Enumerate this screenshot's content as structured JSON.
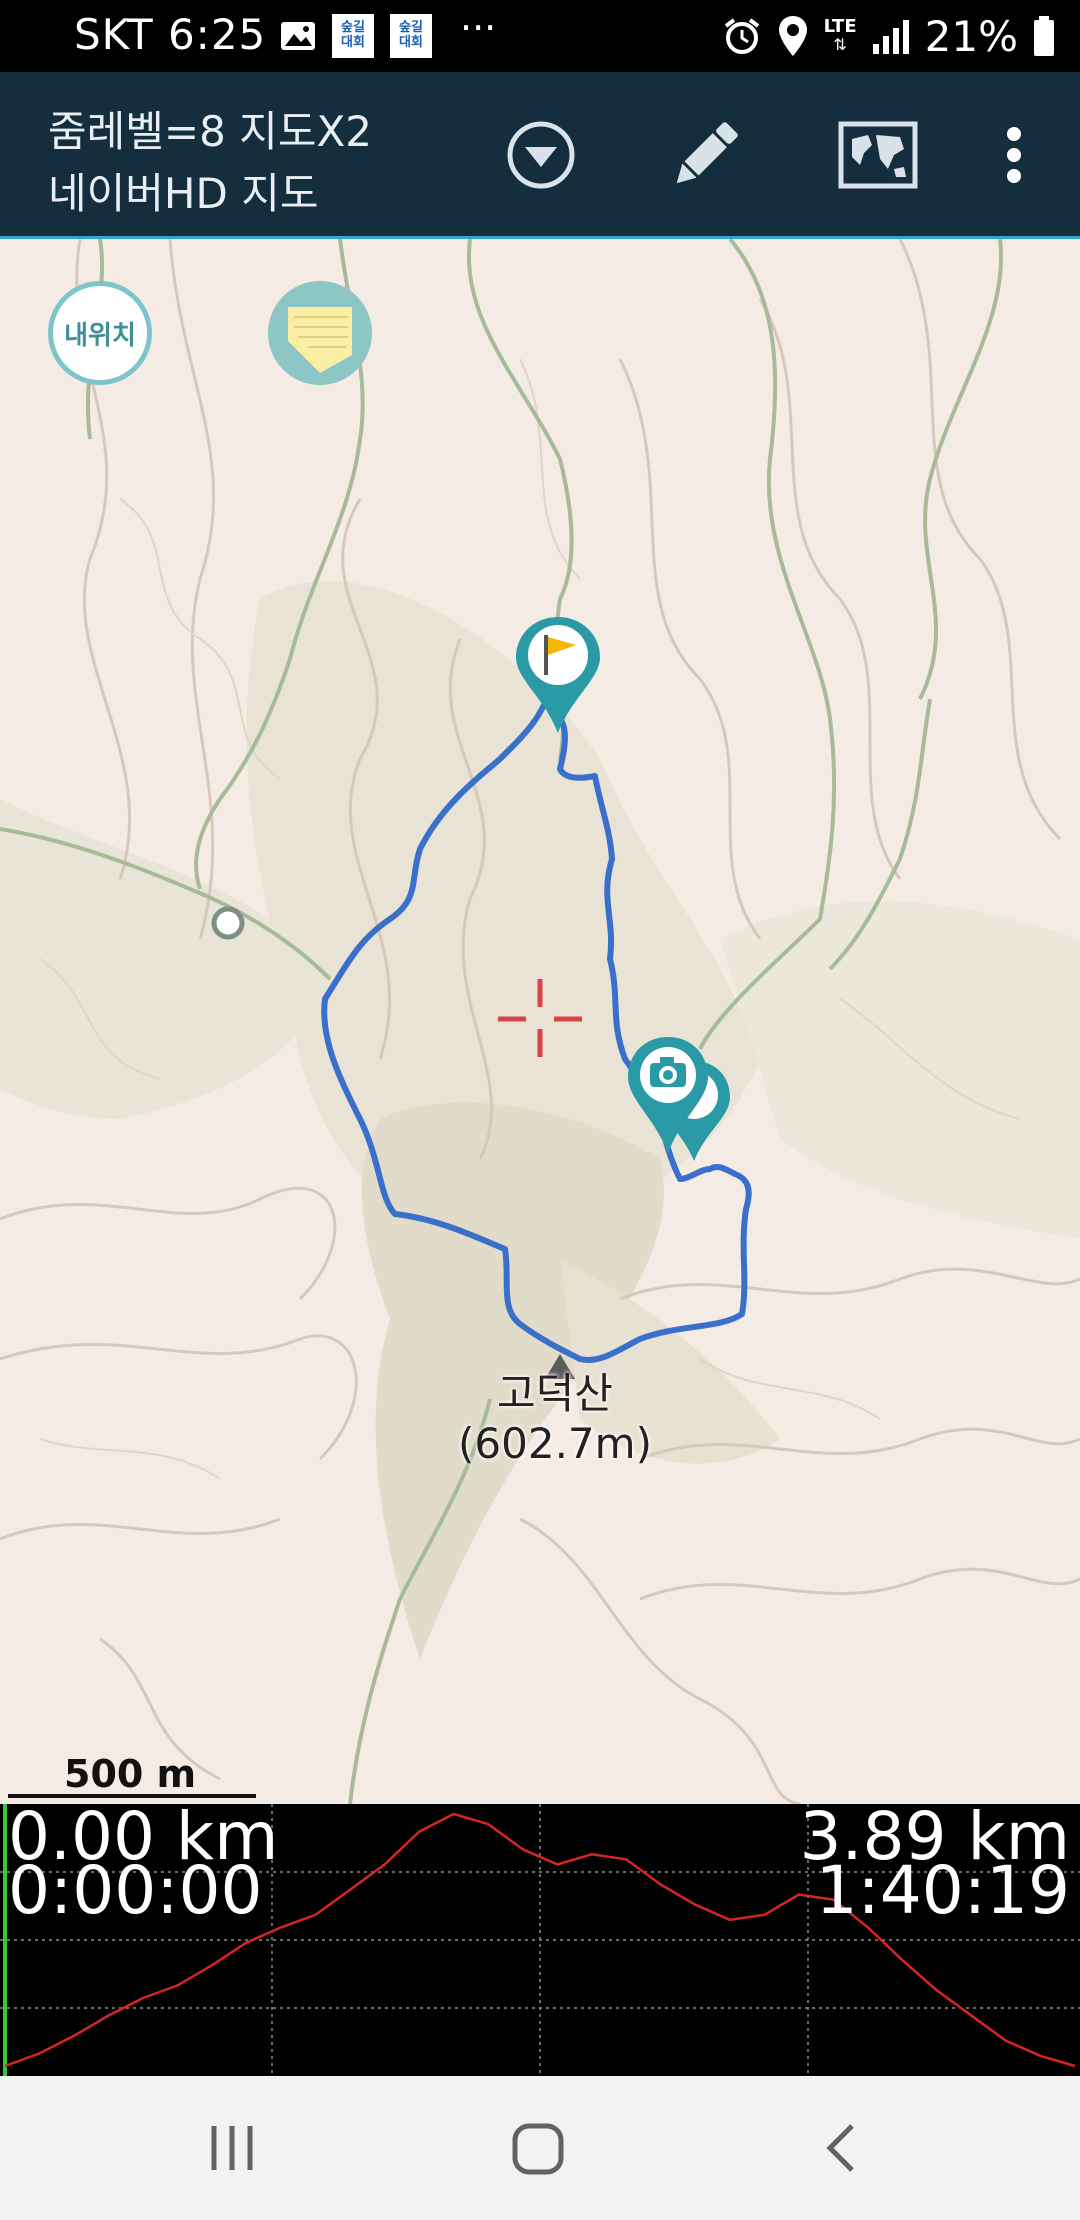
{
  "status_bar": {
    "carrier_time": "SKT 6:25",
    "notif_badge_1": "숲길\n대회",
    "notif_badge_2": "숲길\n대회",
    "more": "···",
    "network": "LTE",
    "battery_percent": "21%"
  },
  "toolbar": {
    "line1": "줌레벨=8 지도X2",
    "line2": "네이버HD 지도"
  },
  "map": {
    "my_location_label": "내위치",
    "peak_name": "고덕산",
    "peak_elevation": "(602.7m)",
    "scale_label": "500 m",
    "route_color": "#3a70cc",
    "marker_color": "#2a9aa6"
  },
  "elevation": {
    "start_distance": "0.00 km",
    "start_time": "0:00:00",
    "end_distance": "3.89 km",
    "end_time": "1:40:19",
    "profile": [
      0.0,
      0.05,
      0.12,
      0.2,
      0.27,
      0.32,
      0.4,
      0.49,
      0.55,
      0.6,
      0.7,
      0.8,
      0.93,
      1.0,
      0.96,
      0.86,
      0.8,
      0.84,
      0.82,
      0.72,
      0.64,
      0.58,
      0.6,
      0.68,
      0.66,
      0.55,
      0.42,
      0.3,
      0.2,
      0.1,
      0.04,
      0.0
    ]
  },
  "navbar": {
    "recents": "recent-apps",
    "home": "home",
    "back": "back"
  }
}
